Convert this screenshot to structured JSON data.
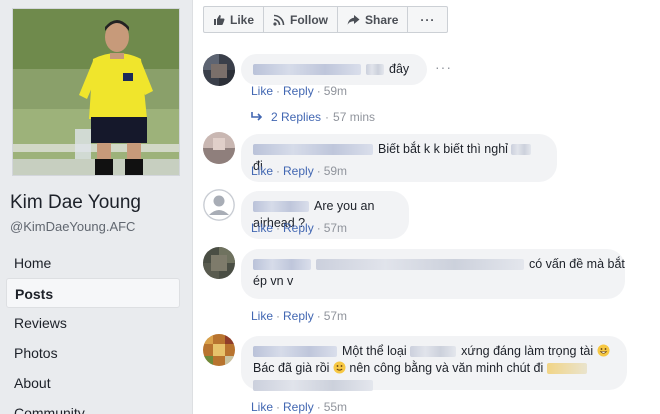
{
  "profile": {
    "name": "Kim Dae Young",
    "handle": "@KimDaeYoung.AFC"
  },
  "nav": {
    "items": [
      {
        "label": "Home",
        "active": false
      },
      {
        "label": "Posts",
        "active": true
      },
      {
        "label": "Reviews",
        "active": false
      },
      {
        "label": "Photos",
        "active": false
      },
      {
        "label": "About",
        "active": false
      },
      {
        "label": "Community",
        "active": false
      }
    ]
  },
  "actions": {
    "like": "Like",
    "follow": "Follow",
    "share": "Share",
    "more": "···"
  },
  "comments": [
    {
      "text": "đây",
      "like": "Like",
      "reply": "Reply",
      "time": "59m"
    },
    {
      "text": "Biết bắt k k biết thì nghỉ",
      "text_end": "đi",
      "like": "Like",
      "reply": "Reply",
      "time": "59m"
    },
    {
      "text": "Are you an airhead ?",
      "like": "Like",
      "reply": "Reply",
      "time": "57m"
    },
    {
      "line1_end": "có vấn đề mà bắt",
      "line2": "ép vn v",
      "like": "Like",
      "reply": "Reply",
      "time": "57m"
    },
    {
      "line1_a": "Một thể loại",
      "line1_b": "xứng đáng làm trọng tài",
      "line2_a": "Bác đã già rồi",
      "line2_b": "nên công bằng và văn minh chút đi",
      "like": "Like",
      "reply": "Reply",
      "time": "55m"
    }
  ],
  "replies_link": {
    "label": "2 Replies",
    "time": "57 mins"
  },
  "colors": {
    "link": "#4267b2",
    "bubble": "#f2f3f5",
    "meta": "#90949c"
  }
}
